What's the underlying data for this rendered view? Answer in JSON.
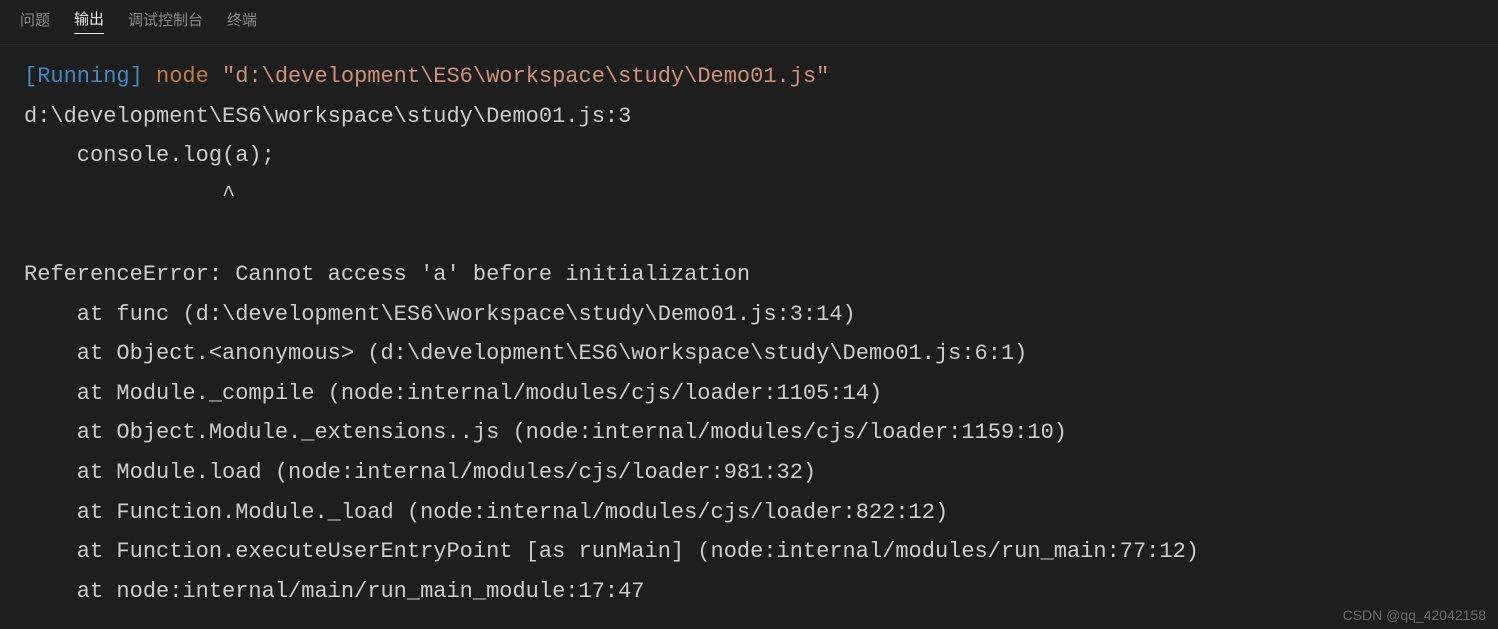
{
  "tabs": {
    "problems": "问题",
    "output": "输出",
    "debug_console": "调试控制台",
    "terminal": "终端"
  },
  "output": {
    "running_tag": "[Running]",
    "cmd": "node",
    "cmd_arg": "\"d:\\development\\ES6\\workspace\\study\\Demo01.js\"",
    "err_loc": "d:\\development\\ES6\\workspace\\study\\Demo01.js:3",
    "err_code": "    console.log(a);",
    "err_caret": "               ^",
    "err_msg": "ReferenceError: Cannot access 'a' before initialization",
    "stack": [
      "    at func (d:\\development\\ES6\\workspace\\study\\Demo01.js:3:14)",
      "    at Object.<anonymous> (d:\\development\\ES6\\workspace\\study\\Demo01.js:6:1)",
      "    at Module._compile (node:internal/modules/cjs/loader:1105:14)",
      "    at Object.Module._extensions..js (node:internal/modules/cjs/loader:1159:10)",
      "    at Module.load (node:internal/modules/cjs/loader:981:32)",
      "    at Function.Module._load (node:internal/modules/cjs/loader:822:12)",
      "    at Function.executeUserEntryPoint [as runMain] (node:internal/modules/run_main:77:12)",
      "    at node:internal/main/run_main_module:17:47"
    ]
  },
  "watermark": "CSDN @qq_42042158"
}
